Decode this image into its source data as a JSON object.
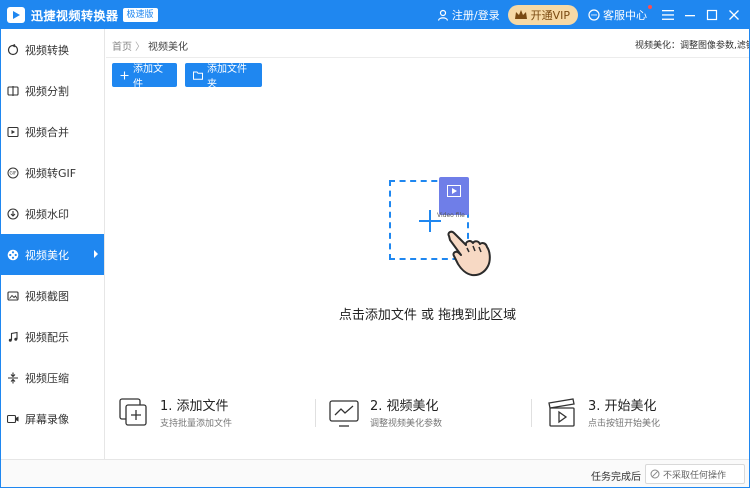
{
  "app": {
    "title": "迅捷视频转换器",
    "edition_badge": "极速版"
  },
  "titlebar": {
    "login_label": "注册/登录",
    "vip_label": "开通VIP",
    "support_label": "客服中心"
  },
  "sidebar": {
    "items": [
      {
        "label": "视频转换",
        "icon": "refresh-icon"
      },
      {
        "label": "视频分割",
        "icon": "split-icon"
      },
      {
        "label": "视频合并",
        "icon": "merge-icon"
      },
      {
        "label": "视频转GIF",
        "icon": "gif-icon"
      },
      {
        "label": "视频水印",
        "icon": "watermark-icon"
      },
      {
        "label": "视频美化",
        "icon": "film-reel-icon",
        "active": true
      },
      {
        "label": "视频截图",
        "icon": "screenshot-icon"
      },
      {
        "label": "视频配乐",
        "icon": "music-icon"
      },
      {
        "label": "视频压缩",
        "icon": "compress-icon"
      },
      {
        "label": "屏幕录像",
        "icon": "record-icon"
      }
    ]
  },
  "breadcrumb": {
    "home": "首页",
    "separator": "〉",
    "current": "视频美化"
  },
  "page_desc": "视频美化：调整图像参数,滤镜库",
  "toolbar": {
    "add_file_label": "添加文件",
    "add_folder_label": "添加文件夹"
  },
  "drop_zone": {
    "file_caption": "Video file",
    "text": "点击添加文件 或 拖拽到此区域"
  },
  "steps": [
    {
      "title": "1. 添加文件",
      "desc": "支持批量添加文件",
      "icon": "add-files-icon"
    },
    {
      "title": "2. 视频美化",
      "desc": "调整视频美化参数",
      "icon": "monitor-chart-icon"
    },
    {
      "title": "3. 开始美化",
      "desc": "点击按钮开始美化",
      "icon": "clapper-play-icon"
    }
  ],
  "bottom": {
    "after_label": "任务完成后",
    "after_value": "不采取任何操作"
  },
  "colors": {
    "accent": "#1f87f0",
    "vip_bg": "#f6d9a6",
    "file_tile": "#6f7ee8",
    "hand_skin": "#f7d9c4"
  }
}
